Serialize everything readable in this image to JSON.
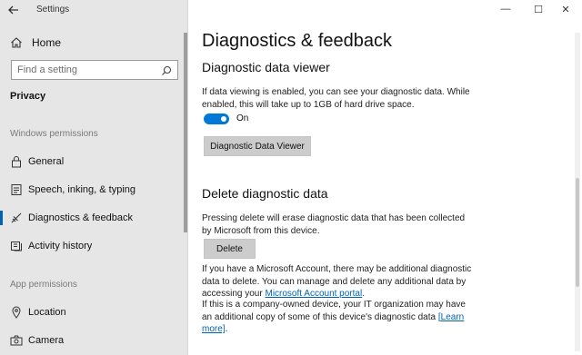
{
  "window": {
    "title": "Settings",
    "controls": {
      "minimize": "—",
      "maximize": "☐",
      "close": "✕"
    }
  },
  "sidebar": {
    "home_label": "Home",
    "search_placeholder": "Find a setting",
    "section_title": "Privacy",
    "group_windows": "Windows permissions",
    "items": [
      {
        "label": "General",
        "icon": "lock-icon"
      },
      {
        "label": "Speech, inking, & typing",
        "icon": "speech-icon"
      },
      {
        "label": "Diagnostics & feedback",
        "icon": "diagnostics-icon",
        "active": true
      },
      {
        "label": "Activity history",
        "icon": "activity-icon"
      }
    ],
    "group_app": "App permissions",
    "app_items": [
      {
        "label": "Location",
        "icon": "location-icon"
      },
      {
        "label": "Camera",
        "icon": "camera-icon"
      }
    ]
  },
  "main": {
    "title": "Diagnostics & feedback",
    "viewer": {
      "heading": "Diagnostic data viewer",
      "desc": "If data viewing is enabled, you can see your diagnostic data. While enabled, this will take up to 1GB of hard drive space.",
      "toggle_state": "On",
      "toggle_on": true,
      "button": "Diagnostic Data Viewer"
    },
    "delete": {
      "heading": "Delete diagnostic data",
      "desc": "Pressing delete will erase diagnostic data that has been collected by Microsoft from this device.",
      "button": "Delete",
      "account_text": "If you have a Microsoft Account, there may be additional diagnostic data to delete. You can manage and delete any additional data by accessing your",
      "account_link": "Microsoft Account portal",
      "account_end": ".",
      "company_text": "If this is a company-owned device, your IT organization may have an additional copy of some of this device's diagnostic data",
      "learn_link": "[Learn more]",
      "company_end": "."
    }
  },
  "colors": {
    "accent": "#0078d7",
    "link": "#0063b1",
    "sidebar_bg": "#e6e6e6"
  }
}
